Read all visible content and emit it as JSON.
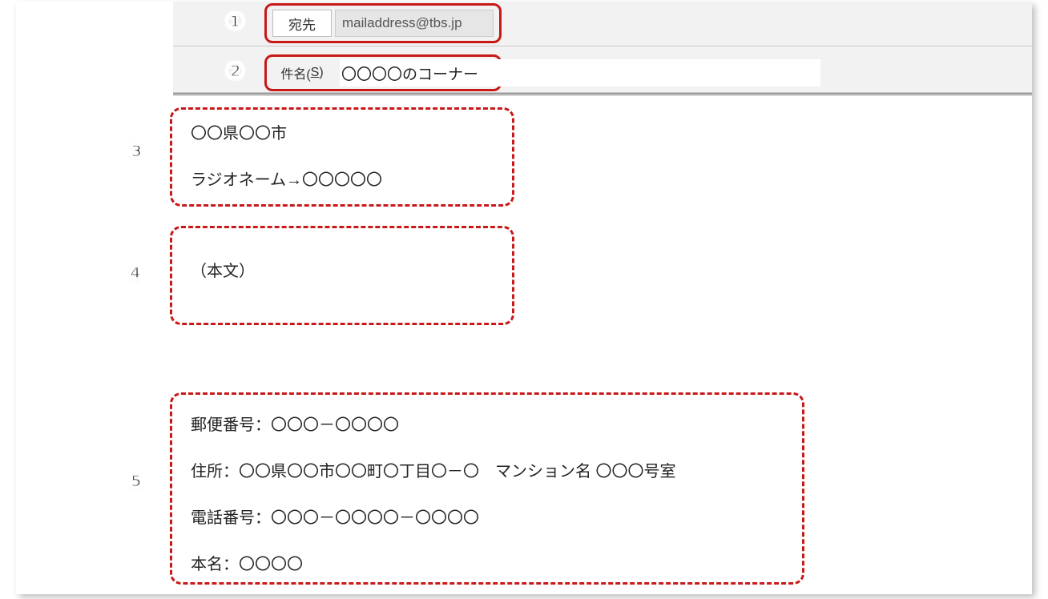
{
  "numbers": {
    "n1": "①",
    "n2": "②",
    "n3": "③",
    "n4": "④",
    "n5": "⑤"
  },
  "header": {
    "to_label": "宛先",
    "to_value": "mailaddress@tbs.jp",
    "subject_label_pre": "件名(",
    "subject_label_key": "S",
    "subject_label_post": ")",
    "subject_value": "〇〇〇〇のコーナー"
  },
  "section3": {
    "line1": "〇〇県〇〇市",
    "line2": "ラジオネーム→〇〇〇〇〇"
  },
  "section4": {
    "line1": "（本文）"
  },
  "section5": {
    "line1": "郵便番号：〇〇〇－〇〇〇〇",
    "line2": "住所：〇〇県〇〇市〇〇町〇丁目〇－〇　マンション名 〇〇〇号室",
    "line3": "電話番号：〇〇〇－〇〇〇〇－〇〇〇〇",
    "line4": "本名：〇〇〇〇"
  }
}
